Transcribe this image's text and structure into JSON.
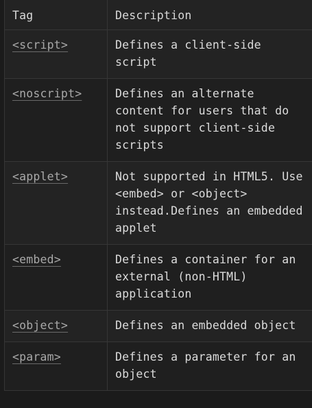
{
  "table": {
    "headers": {
      "tag": "Tag",
      "description": "Description"
    },
    "rows": [
      {
        "tag": "<script>",
        "description": "Defines a client-side script"
      },
      {
        "tag": "<noscript>",
        "description": "Defines an alternate content for users that do not support client-side scripts"
      },
      {
        "tag": "<applet>",
        "description": "Not supported in HTML5. Use <embed> or <object> instead.Defines an embedded applet"
      },
      {
        "tag": "<embed>",
        "description": "Defines a container for an external (non-HTML) application"
      },
      {
        "tag": "<object>",
        "description": "Defines an embedded object"
      },
      {
        "tag": "<param>",
        "description": "Defines a parameter for an object"
      }
    ]
  }
}
